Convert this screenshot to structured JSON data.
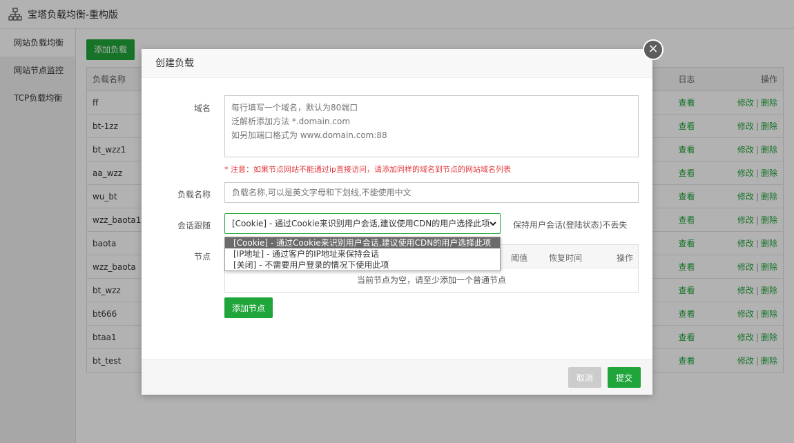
{
  "app": {
    "title": "宝塔负载均衡-重构版"
  },
  "sidebar": {
    "items": [
      {
        "label": "网站负载均衡"
      },
      {
        "label": "网站节点监控"
      },
      {
        "label": "TCP负载均衡"
      }
    ]
  },
  "main": {
    "add_button": "添加负载",
    "table": {
      "headers": {
        "name": "负载名称",
        "log": "日志",
        "ops": "操作"
      },
      "rows": [
        {
          "name": "ff"
        },
        {
          "name": "bt-1zz"
        },
        {
          "name": "bt_wzz1"
        },
        {
          "name": "aa_wzz"
        },
        {
          "name": "wu_bt"
        },
        {
          "name": "wzz_baota1"
        },
        {
          "name": "baota"
        },
        {
          "name": "wzz_baota"
        },
        {
          "name": "bt_wzz"
        },
        {
          "name": "bt666"
        },
        {
          "name": "btaa1"
        },
        {
          "name": "bt_test"
        }
      ],
      "log_link": "查看",
      "edit_link": "修改",
      "delete_link": "删除",
      "separator": "|"
    }
  },
  "modal": {
    "title": "创建负载",
    "close_icon": "×",
    "domain_label": "域名",
    "domain_placeholder": "每行填写一个域名，默认为80端口\n泛解析添加方法 *.domain.com\n如另加端口格式为 www.domain.com:88",
    "warning": "* 注意：如果节点网站不能通过ip直接访问，请添加同样的域名到节点的网站域名列表",
    "name_label": "负载名称",
    "name_placeholder": "负载名称,可以是英文字母和下划线,不能使用中文",
    "session_label": "会话跟随",
    "session_selected": "[Cookie] - 通过Cookie来识别用户会话,建议使用CDN的用户选择此项",
    "session_hint": "保持用户会话(登陆状态)不丢失",
    "session_options": [
      "[Cookie] - 通过Cookie来识别用户会话,建议使用CDN的用户选择此项",
      "[IP地址] - 通过客户的IP地址来保持会话",
      "[关闭] - 不需要用户登录的情况下使用此项"
    ],
    "node_label": "节点",
    "node_headers": {
      "threshold": "阈值",
      "recover": "恢复时间",
      "ops": "操作"
    },
    "node_empty": "当前节点为空，请至少添加一个普通节点",
    "add_node_button": "添加节点",
    "cancel_button": "取消",
    "submit_button": "提交"
  },
  "colors": {
    "brand": "#20a53a",
    "warning": "#e4393c"
  }
}
